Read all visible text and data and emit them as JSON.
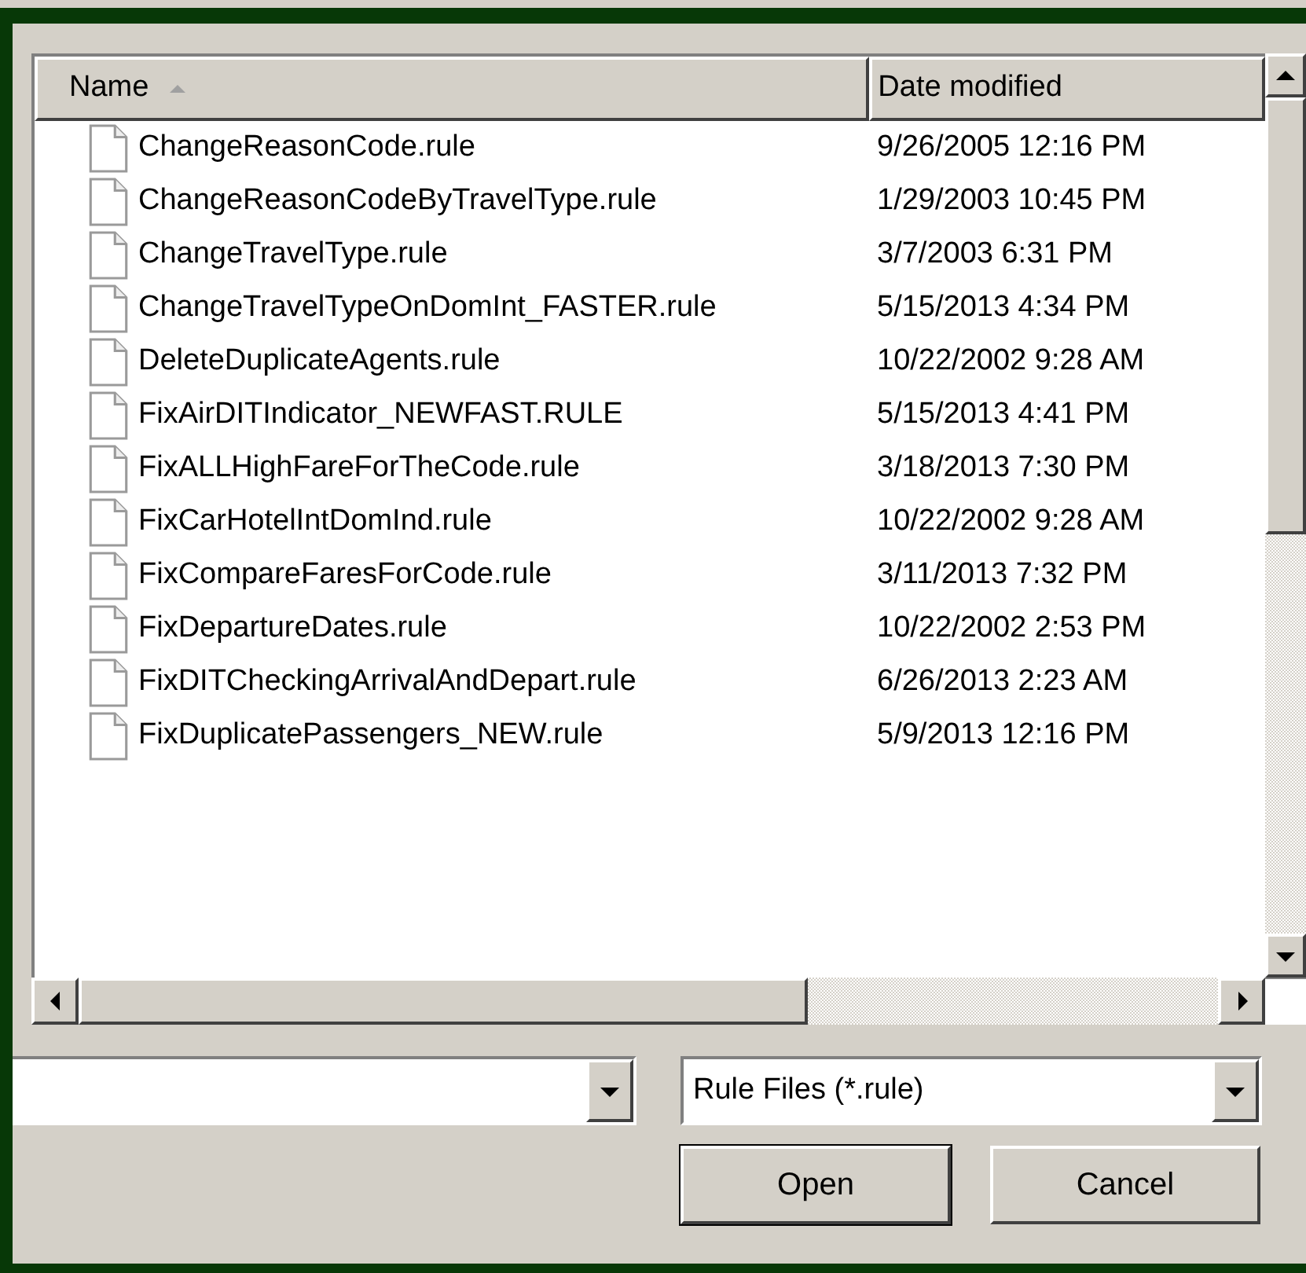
{
  "columns": [
    {
      "label": "Name",
      "sorted": true
    },
    {
      "label": "Date modified",
      "sorted": false
    }
  ],
  "files": [
    {
      "name": "ChangeReasonCode.rule",
      "date": "9/26/2005 12:16 PM"
    },
    {
      "name": "ChangeReasonCodeByTravelType.rule",
      "date": "1/29/2003 10:45 PM"
    },
    {
      "name": "ChangeTravelType.rule",
      "date": "3/7/2003 6:31 PM"
    },
    {
      "name": "ChangeTravelTypeOnDomInt_FASTER.rule",
      "date": "5/15/2013 4:34 PM"
    },
    {
      "name": "DeleteDuplicateAgents.rule",
      "date": "10/22/2002 9:28 AM"
    },
    {
      "name": "FixAirDITIndicator_NEWFAST.RULE",
      "date": "5/15/2013 4:41 PM"
    },
    {
      "name": "FixALLHighFareForTheCode.rule",
      "date": "3/18/2013 7:30 PM"
    },
    {
      "name": "FixCarHotelIntDomInd.rule",
      "date": "10/22/2002 9:28 AM"
    },
    {
      "name": "FixCompareFaresForCode.rule",
      "date": "3/11/2013 7:32 PM"
    },
    {
      "name": "FixDepartureDates.rule",
      "date": "10/22/2002 2:53 PM"
    },
    {
      "name": "FixDITCheckingArrivalAndDepart.rule",
      "date": "6/26/2013 2:23 AM"
    },
    {
      "name": "FixDuplicatePassengers_NEW.rule",
      "date": "5/9/2013 12:16 PM"
    }
  ],
  "file_type": {
    "value": "Rule Files (*.rule)"
  },
  "buttons": [
    {
      "label": "Open",
      "default": true
    },
    {
      "label": "Cancel",
      "default": false
    }
  ]
}
